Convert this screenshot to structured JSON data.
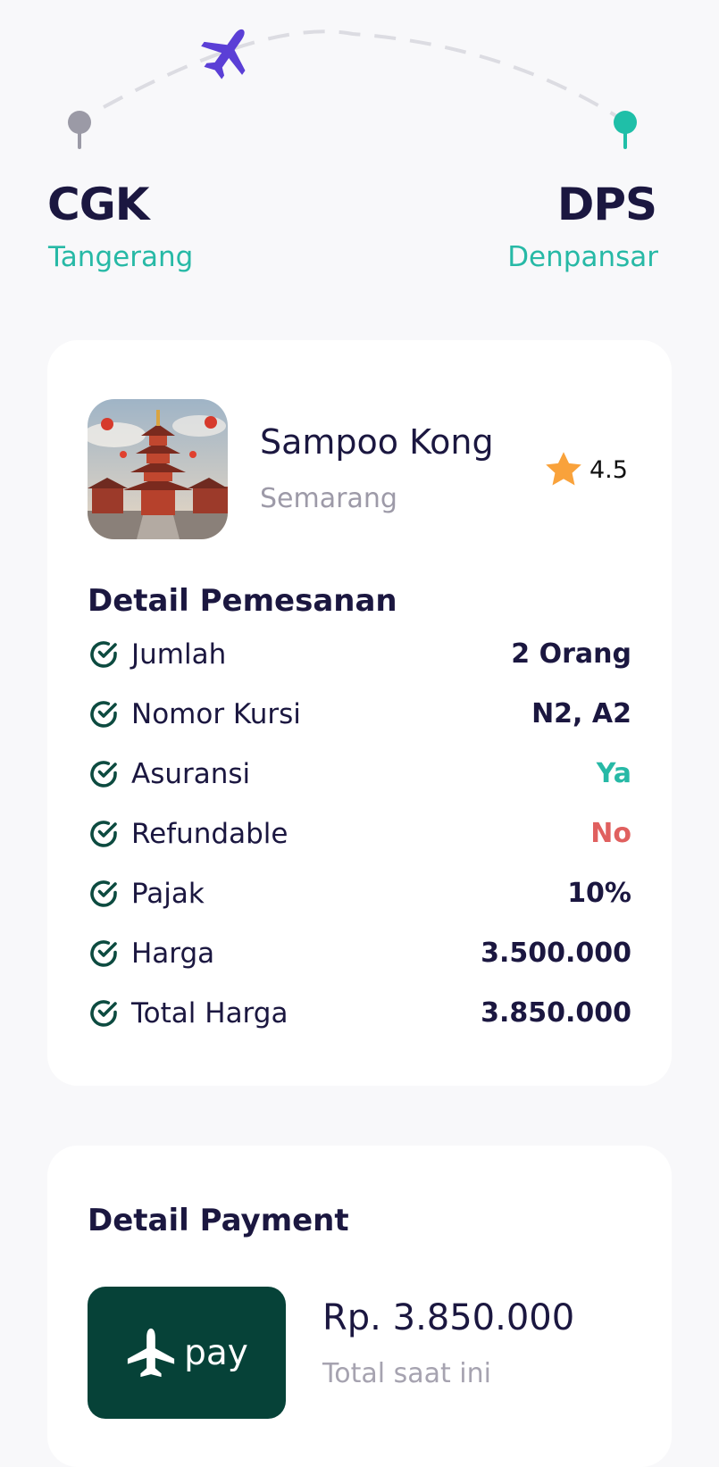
{
  "route": {
    "from": {
      "code": "CGK",
      "city": "Tangerang"
    },
    "to": {
      "code": "DPS",
      "city": "Denpansar"
    },
    "colors": {
      "from_pin": "#9b9aa6",
      "to_pin": "#1fbfa8",
      "plane": "#5b3fd6",
      "path": "#dcdce2"
    }
  },
  "destination": {
    "name": "Sampoo Kong",
    "city": "Semarang",
    "rating": "4.5",
    "image_icon": "temple-photo",
    "star_color": "#f9a23b"
  },
  "booking": {
    "title": "Detail Pemesanan",
    "rows": [
      {
        "label": "Jumlah",
        "value": "2 Orang",
        "color": "#1b1740"
      },
      {
        "label": "Nomor Kursi",
        "value": "N2, A2",
        "color": "#1b1740"
      },
      {
        "label": "Asuransi",
        "value": "Ya",
        "color": "#27b9a6"
      },
      {
        "label": "Refundable",
        "value": "No",
        "color": "#e0605f"
      },
      {
        "label": "Pajak",
        "value": "10%",
        "color": "#1b1740"
      },
      {
        "label": "Harga",
        "value": "3.500.000",
        "color": "#1b1740"
      },
      {
        "label": "Total Harga",
        "value": "3.850.000",
        "color": "#1b1740"
      }
    ]
  },
  "payment": {
    "title": "Detail Payment",
    "button_label": "pay",
    "amount": "Rp. 3.850.000",
    "amount_caption": "Total saat ini",
    "button_color": "#064238"
  }
}
